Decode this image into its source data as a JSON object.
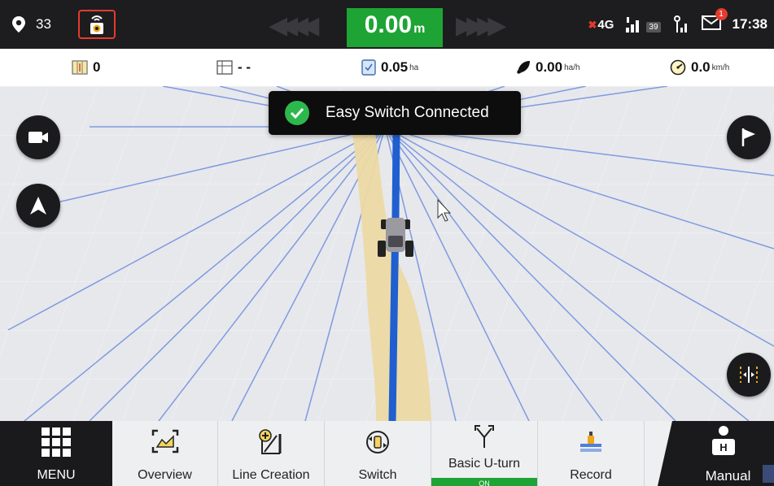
{
  "status": {
    "satellite_count": "33",
    "speed_value": "0.00",
    "speed_unit": "m",
    "network": "4G",
    "signal_badge": "39",
    "mail_count": "1",
    "time": "17:38",
    "icons": [
      "location-pin-icon",
      "receiver-icon",
      "signal-icon",
      "antenna-icon",
      "mail-icon"
    ]
  },
  "stats": {
    "pass_count": "0",
    "field_value": "- -",
    "area_value": "0.05",
    "area_unit": "ha",
    "rate_value": "0.00",
    "rate_unit": "ha/h",
    "speed_value": "0.0",
    "speed_unit": "km/h"
  },
  "toast": {
    "message": "Easy Switch Connected"
  },
  "toolbar": {
    "menu": "MENU",
    "overview": "Overview",
    "line_creation": "Line Creation",
    "switch": "Switch",
    "basic_uturn": "Basic U-turn",
    "basic_uturn_state": "ON",
    "record": "Record",
    "manual": "Manual"
  },
  "colors": {
    "accent_green": "#1ea434",
    "guidance_blue": "#1f5fd0",
    "lane_tan": "#ecd9a4",
    "highlight_red": "#e53a2f"
  }
}
